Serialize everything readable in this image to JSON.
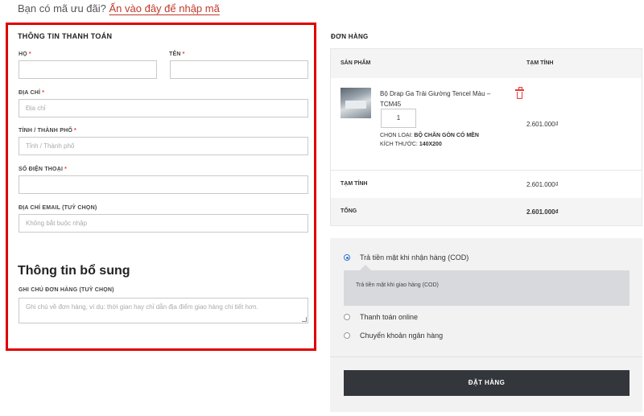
{
  "coupon": {
    "prompt": "Bạn có mã ưu đãi?",
    "link": "Ấn vào đây để nhập mã"
  },
  "billing": {
    "title": "THÔNG TIN THANH TOÁN",
    "last_name_label": "HỌ",
    "first_name_label": "TÊN",
    "address_label": "ĐỊA CHỈ",
    "address_placeholder": "Địa chỉ",
    "city_label": "TỈNH / THÀNH PHỐ",
    "city_placeholder": "Tỉnh / Thành phố",
    "phone_label": "SỐ ĐIỆN THOẠI",
    "email_label": "ĐỊA CHỈ EMAIL (TUỲ CHỌN)",
    "email_placeholder": "Không bắt buộc nhập",
    "required_mark": "*"
  },
  "additional": {
    "title": "Thông tin bổ sung",
    "notes_label": "GHI CHÚ ĐƠN HÀNG (TUỲ CHỌN)",
    "notes_placeholder": "Ghi chú về đơn hàng, ví dụ: thời gian hay chỉ dẫn địa điểm giao hàng chi tiết hơn."
  },
  "order": {
    "title": "ĐƠN HÀNG",
    "col_product": "SẢN PHẨM",
    "col_subtotal": "TẠM TÍNH",
    "item": {
      "name": "Bộ Drap Ga Trải Giường Tencel Màu – TCM45",
      "quantity": "1",
      "type_label": "CHỌN LOẠI:",
      "type_value": "BỘ CHĂN GÒN CÓ MỀN",
      "size_label": "KÍCH THƯỚC:",
      "size_value": "140X200",
      "price": "2.601.000₫"
    },
    "subtotal_label": "TẠM TÍNH",
    "subtotal_value": "2.601.000₫",
    "total_label": "TỔNG",
    "total_value": "2.601.000₫"
  },
  "payment": {
    "options": [
      {
        "label": "Trả tiền mặt khi nhận hàng (COD)",
        "selected": true
      },
      {
        "label": "Thanh toán online",
        "selected": false
      },
      {
        "label": "Chuyển khoản ngân hàng",
        "selected": false
      }
    ],
    "cod_description": "Trả tiền mặt khi giao hàng (COD)",
    "place_order_label": "ĐẶT HÀNG"
  },
  "colors": {
    "highlight_border": "#e00000",
    "link": "#c0392b",
    "button": "#33373c",
    "radio_selected": "#2f6fd0",
    "delete_icon": "#e53935"
  }
}
